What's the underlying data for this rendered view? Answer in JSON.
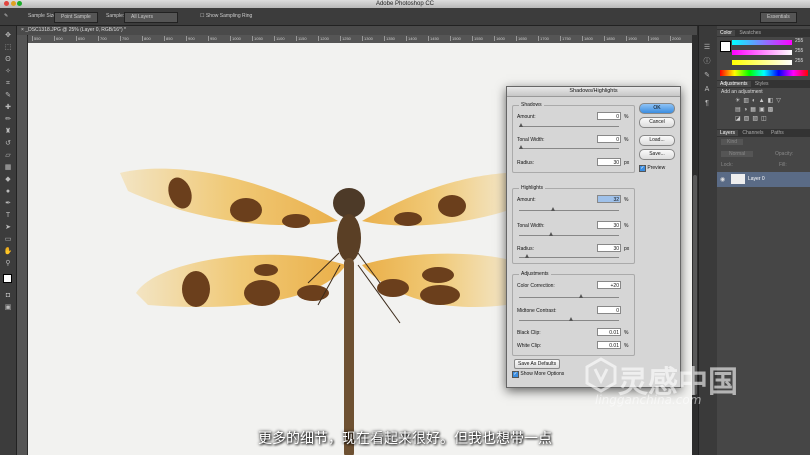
{
  "app": {
    "title": "Adobe Photoshop CC"
  },
  "options_bar": {
    "sample_size_label": "Sample Size:",
    "sample_size_value": "Point Sample",
    "sample_label": "Sample:",
    "sample_value": "All Layers",
    "show_ring_label": "Show Sampling Ring",
    "workspace": "Essentials"
  },
  "document_tab": {
    "title": "_DSC1318.JPG @ 25% (Layer 0, RGB/16*) *"
  },
  "ruler": {
    "ticks": [
      "550",
      "600",
      "650",
      "700",
      "750",
      "800",
      "850",
      "900",
      "950",
      "1000",
      "1050",
      "1100",
      "1150",
      "1200",
      "1250",
      "1300",
      "1350",
      "1400",
      "1450",
      "1500",
      "1550",
      "1600",
      "1650",
      "1700",
      "1750",
      "1800",
      "1850",
      "1900",
      "1950",
      "2000"
    ]
  },
  "panels": {
    "color_tabs": [
      "Color",
      "Swatches"
    ],
    "color_values": {
      "r": "255",
      "g": "255",
      "b": "255"
    },
    "adjustments_tabs": [
      "Adjustments",
      "Styles"
    ],
    "adjustments_heading": "Add an adjustment",
    "layers_tabs": [
      "Layers",
      "Channels",
      "Paths"
    ],
    "layer_kind": "Kind",
    "blend_mode": "Normal",
    "opacity_label": "Opacity:",
    "fill_label": "Fill:",
    "lock_label": "Lock:",
    "layer_name": "Layer 0"
  },
  "dialog": {
    "title": "Shadows/Highlights",
    "shadows": {
      "heading": "Shadows",
      "amount_label": "Amount:",
      "amount": "0",
      "amount_unit": "%",
      "tonal_label": "Tonal Width:",
      "tonal": "0",
      "tonal_unit": "%",
      "radius_label": "Radius:",
      "radius": "30",
      "radius_unit": "px"
    },
    "highlights": {
      "heading": "Highlights",
      "amount_label": "Amount:",
      "amount": "32",
      "amount_unit": "%",
      "tonal_label": "Tonal Width:",
      "tonal": "30",
      "tonal_unit": "%",
      "radius_label": "Radius:",
      "radius": "30",
      "radius_unit": "px"
    },
    "adjustments": {
      "heading": "Adjustments",
      "color_label": "Color Correction:",
      "color": "+20",
      "midtone_label": "Midtone Contrast:",
      "midtone": "0",
      "black_label": "Black Clip:",
      "black": "0.01",
      "black_unit": "%",
      "white_label": "White Clip:",
      "white": "0.01",
      "white_unit": "%"
    },
    "ok": "OK",
    "cancel": "Cancel",
    "load": "Load...",
    "save": "Save...",
    "preview": "Preview",
    "save_defaults": "Save As Defaults",
    "show_more": "Show More Options"
  },
  "subtitle": "更多的细节，现在看起来很好。但我也想带一点",
  "watermark": {
    "name": "灵感中国",
    "url": "lingganchina.com"
  },
  "colors": {
    "accent": "#3b8de0",
    "ui_dark": "#3c3c3c",
    "canvas_bg": "#f2f2f0",
    "wing_amber": "#e8a935",
    "wing_brown": "#6b3f1c"
  }
}
